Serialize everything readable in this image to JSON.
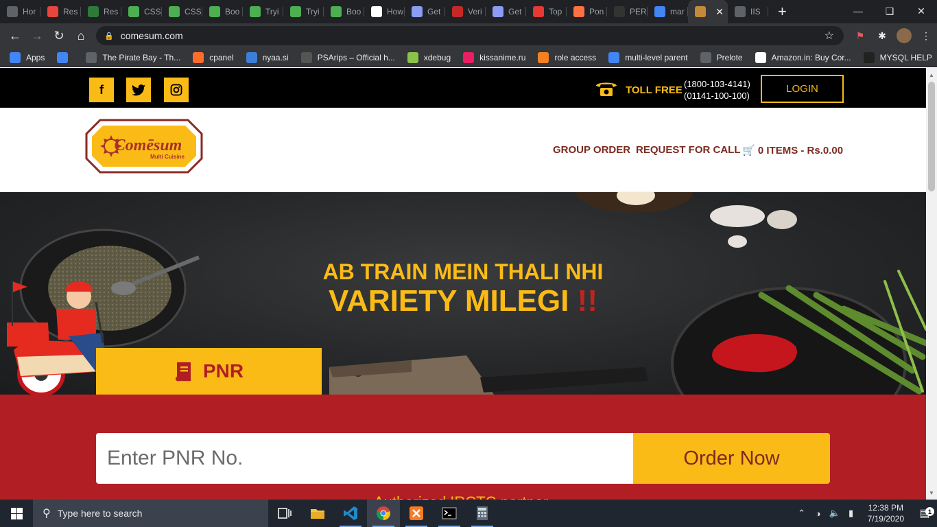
{
  "browser": {
    "tabs": [
      {
        "title": "Hor",
        "icon": "globe-icon",
        "color": "#5f6368"
      },
      {
        "title": "Res",
        "icon": "s-icon",
        "color": "#e8453c"
      },
      {
        "title": "Res",
        "icon": "glyph-icon",
        "color": "#2d7a3a"
      },
      {
        "title": "CSS",
        "icon": "w3-icon",
        "color": "#4caf50"
      },
      {
        "title": "CSS",
        "icon": "w3-icon",
        "color": "#4caf50"
      },
      {
        "title": "Boo",
        "icon": "w3-icon",
        "color": "#4caf50"
      },
      {
        "title": "Tryi",
        "icon": "w3-icon",
        "color": "#4caf50"
      },
      {
        "title": "Tryi",
        "icon": "w3-icon",
        "color": "#4caf50"
      },
      {
        "title": "Boo",
        "icon": "w3-icon",
        "color": "#4caf50"
      },
      {
        "title": "How",
        "icon": "medium-icon",
        "color": "#ffffff"
      },
      {
        "title": "Get",
        "icon": "heart-icon",
        "color": "#8b9cf5"
      },
      {
        "title": "Veri",
        "icon": "mail-icon",
        "color": "#c62828"
      },
      {
        "title": "Get",
        "icon": "heart-icon",
        "color": "#8b9cf5"
      },
      {
        "title": "Top",
        "icon": "gmail-icon",
        "color": "#e53935"
      },
      {
        "title": "Pon",
        "icon": "fire-icon",
        "color": "#ff7043"
      },
      {
        "title": "PER",
        "icon": "e-icon",
        "color": "#333333"
      },
      {
        "title": "mar",
        "icon": "google-icon",
        "color": "#4285f4"
      },
      {
        "title": "",
        "icon": "comesum-icon",
        "color": "#c28a3a",
        "active": true
      },
      {
        "title": "IIS",
        "icon": "globe-icon",
        "color": "#5f6368"
      }
    ],
    "url": "comesum.com",
    "bookmarks": [
      {
        "label": "Apps",
        "icon": "apps-grid-icon",
        "color": "#4285f4"
      },
      {
        "label": "",
        "icon": "google-icon",
        "color": "#4285f4"
      },
      {
        "label": "The Pirate Bay - Th...",
        "icon": "globe-icon",
        "color": "#5f6368"
      },
      {
        "label": "cpanel",
        "icon": "cpanel-icon",
        "color": "#ff6c2c"
      },
      {
        "label": "nyaa.si",
        "icon": "nyaa-icon",
        "color": "#3c7fd8"
      },
      {
        "label": "PSArips – Official h...",
        "icon": "psa-icon",
        "color": "#555555"
      },
      {
        "label": "xdebug",
        "icon": "xdebug-icon",
        "color": "#8bc34a"
      },
      {
        "label": "kissanime.ru",
        "icon": "kiss-icon",
        "color": "#e91e63"
      },
      {
        "label": "role access",
        "icon": "stack-icon",
        "color": "#f48024"
      },
      {
        "label": "multi-level parent",
        "icon": "google-icon",
        "color": "#4285f4"
      },
      {
        "label": "Prelote",
        "icon": "globe-icon",
        "color": "#5f6368"
      },
      {
        "label": "Amazon.in: Buy Cor...",
        "icon": "amazon-icon",
        "color": "#ffffff"
      },
      {
        "label": "MYSQL HELP",
        "icon": "t-icon",
        "color": "#222222"
      }
    ]
  },
  "site": {
    "toll_free_label": "TOLL FREE",
    "phone1": "(1800-103-4141)",
    "phone2": "(01141-100-100)",
    "login_label": "LOGIN",
    "social": [
      "f",
      "twitter",
      "instagram"
    ],
    "logo_text": "Comēsum",
    "logo_sub": "Multi Cuisine",
    "nav": {
      "group_order": "GROUP ORDER",
      "request_call": "REQUEST FOR CALL",
      "cart": "0 ITEMS - Rs.0.00"
    },
    "hero": {
      "line1": "AB TRAIN MEIN THALI NHI",
      "line2": "VARIETY MILEGI",
      "exclaim": "!!"
    },
    "pnr_tab": "PNR",
    "pnr_placeholder": "Enter PNR No.",
    "order_now": "Order Now",
    "authorized": "Authorized IRCTC partner"
  },
  "taskbar": {
    "search_placeholder": "Type here to search",
    "time": "12:38 PM",
    "date": "7/19/2020",
    "notifications": "1"
  },
  "colors": {
    "accent_yellow": "#fbbb17",
    "brand_red": "#b11f24",
    "brand_maroon": "#7b2a20"
  }
}
